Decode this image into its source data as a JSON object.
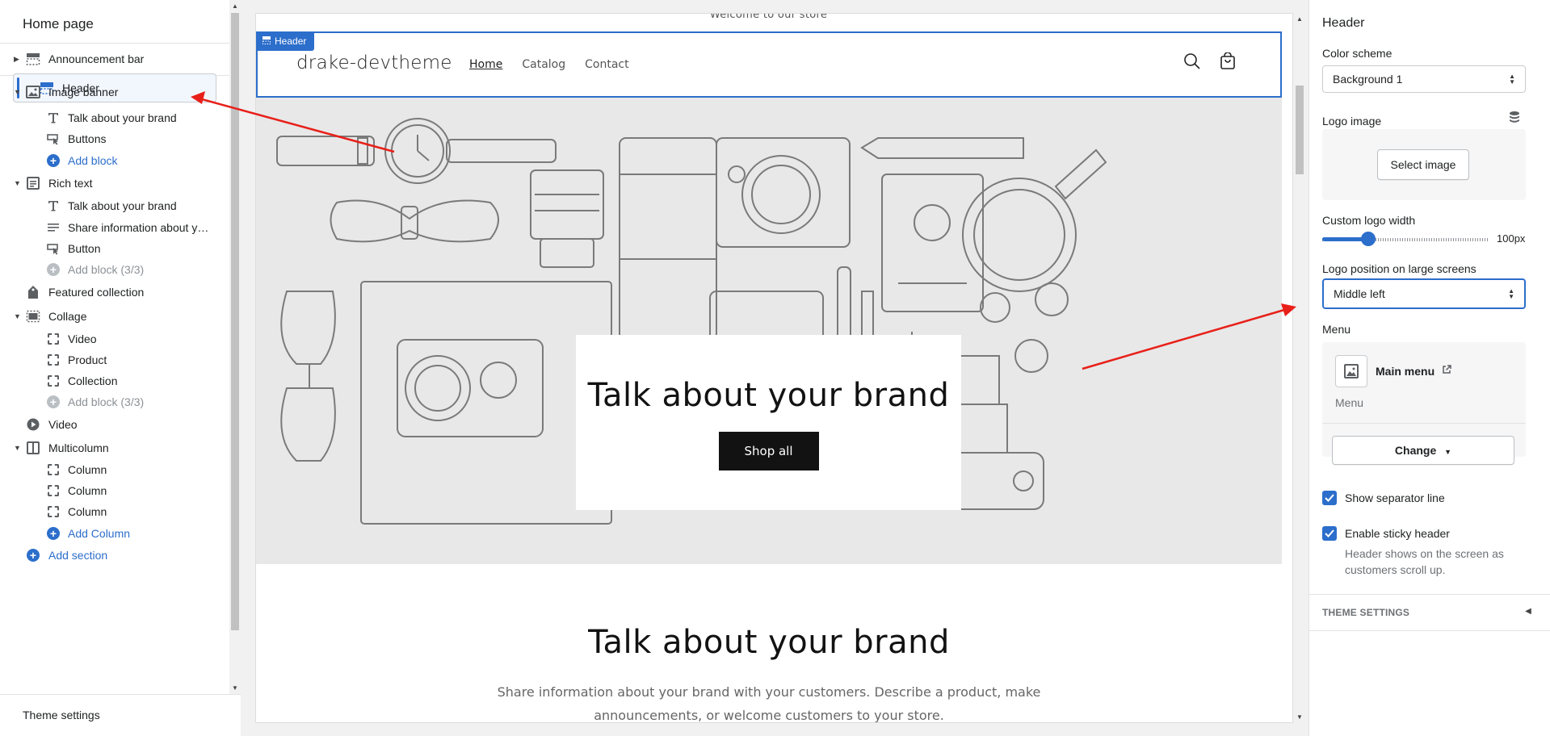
{
  "sidebar": {
    "title": "Home page",
    "footer": "Theme settings",
    "items": [
      {
        "label": "Announcement bar"
      },
      {
        "label": "Header"
      },
      {
        "label": "Image banner"
      },
      {
        "label": "Talk about your brand"
      },
      {
        "label": "Buttons"
      },
      {
        "label": "Add block"
      },
      {
        "label": "Rich text"
      },
      {
        "label": "Talk about your brand"
      },
      {
        "label": "Share information about your brand with your customers"
      },
      {
        "label": "Button"
      },
      {
        "label": "Add block (3/3)"
      },
      {
        "label": "Featured collection"
      },
      {
        "label": "Collage"
      },
      {
        "label": "Video"
      },
      {
        "label": "Product"
      },
      {
        "label": "Collection"
      },
      {
        "label": "Add block (3/3)"
      },
      {
        "label": "Video"
      },
      {
        "label": "Multicolumn"
      },
      {
        "label": "Column"
      },
      {
        "label": "Column"
      },
      {
        "label": "Column"
      },
      {
        "label": "Add Column"
      },
      {
        "label": "Add section"
      }
    ]
  },
  "preview": {
    "announcement": "Welcome to our store",
    "header_tag": "Header",
    "logo": "drake-devtheme",
    "nav": [
      "Home",
      "Catalog",
      "Contact"
    ],
    "banner": {
      "heading": "Talk about your brand",
      "button": "Shop all"
    },
    "rich_text": {
      "heading": "Talk about your brand",
      "body": "Share information about your brand with your customers. Describe a product, make announcements, or welcome customers to your store."
    }
  },
  "settings": {
    "title": "Header",
    "color_scheme_label": "Color scheme",
    "color_scheme_value": "Background 1",
    "logo_image_label": "Logo image",
    "select_image": "Select image",
    "logo_width_label": "Custom logo width",
    "logo_width_value": "100px",
    "logo_width_fraction": 0.22,
    "logo_position_label": "Logo position on large screens",
    "logo_position_value": "Middle left",
    "menu_label": "Menu",
    "menu_name": "Main menu",
    "menu_sub": "Menu",
    "change_button": "Change",
    "show_separator": "Show separator line",
    "sticky_header": "Enable sticky header",
    "sticky_help": "Header shows on the screen as customers scroll up.",
    "theme_settings": "THEME SETTINGS"
  },
  "colors": {
    "accent": "#2c6ecb",
    "annotation_arrow": "#e8201a"
  }
}
